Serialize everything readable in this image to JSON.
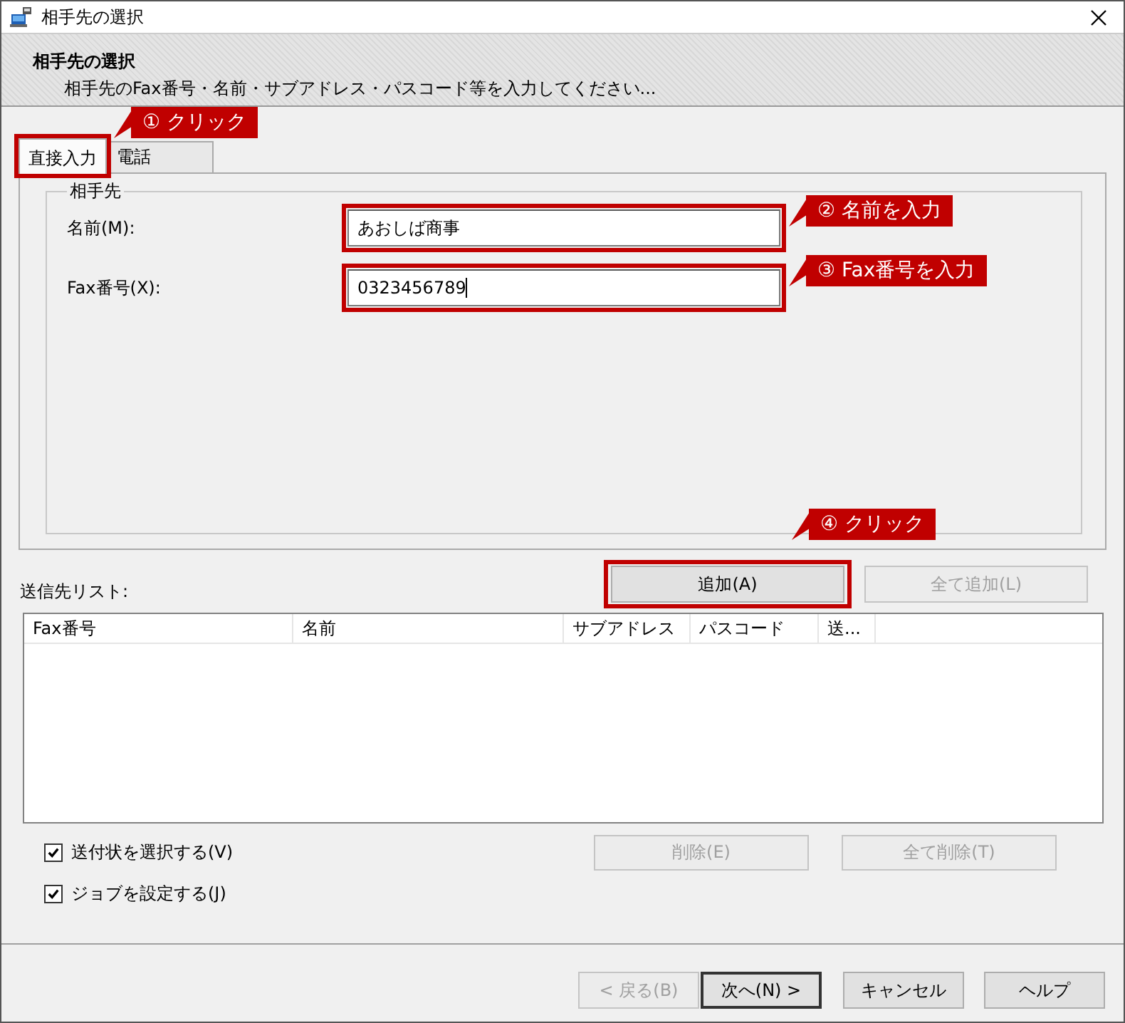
{
  "window": {
    "title": "相手先の選択"
  },
  "header": {
    "title": "相手先の選択",
    "subtitle": "相手先のFax番号・名前・サブアドレス・パスコード等を入力してください..."
  },
  "tabs": [
    {
      "label": "直接入力",
      "selected": true
    },
    {
      "label": "電話",
      "selected": false
    }
  ],
  "recipient_group": {
    "title": "相手先",
    "fields": [
      {
        "label": "名前(M):",
        "value": "あおしば商事"
      },
      {
        "label": "Fax番号(X):",
        "value": "0323456789"
      }
    ]
  },
  "add_buttons": [
    {
      "label": "追加(A)",
      "disabled": false
    },
    {
      "label": "全て追加(L)",
      "disabled": true
    }
  ],
  "destination_list": {
    "label": "送信先リスト:",
    "columns": [
      "Fax番号",
      "名前",
      "サブアドレス",
      "パスコード",
      "送..."
    ]
  },
  "options": [
    {
      "label": "送付状を選択する(V)",
      "checked": true
    },
    {
      "label": "ジョブを設定する(J)",
      "checked": true
    }
  ],
  "remove_buttons": [
    {
      "label": "削除(E)",
      "disabled": true
    },
    {
      "label": "全て削除(T)",
      "disabled": true
    }
  ],
  "footer_buttons": [
    {
      "label": "< 戻る(B)",
      "disabled": true,
      "default": false
    },
    {
      "label": "次へ(N) >",
      "disabled": false,
      "default": true
    },
    {
      "label": "キャンセル",
      "disabled": false,
      "default": false
    },
    {
      "label": "ヘルプ",
      "disabled": false,
      "default": false
    }
  ],
  "annotations": [
    {
      "label": "① クリック"
    },
    {
      "label": "② 名前を入力"
    },
    {
      "label": "③ Fax番号を入力"
    },
    {
      "label": "④ クリック"
    }
  ]
}
